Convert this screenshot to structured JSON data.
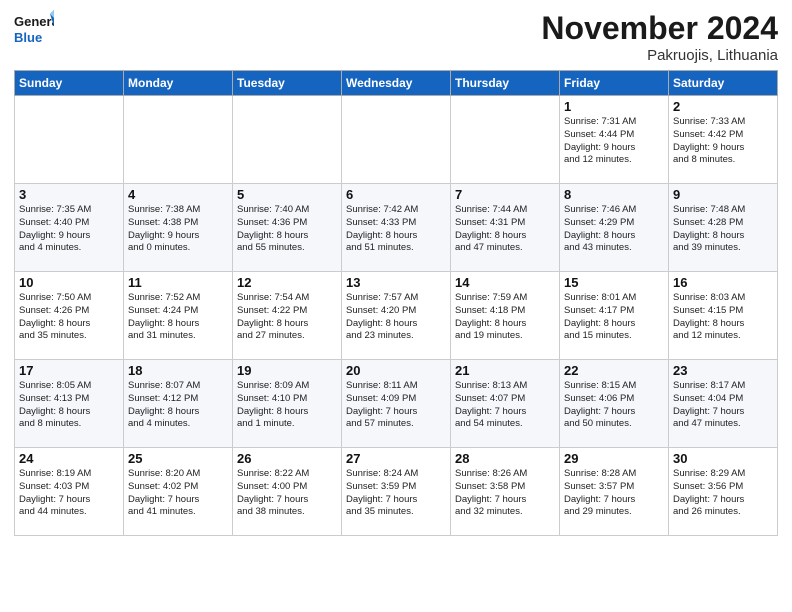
{
  "header": {
    "logo_line1": "General",
    "logo_line2": "Blue",
    "month_title": "November 2024",
    "location": "Pakruojis, Lithuania"
  },
  "days_of_week": [
    "Sunday",
    "Monday",
    "Tuesday",
    "Wednesday",
    "Thursday",
    "Friday",
    "Saturday"
  ],
  "weeks": [
    [
      {
        "day": "",
        "detail": ""
      },
      {
        "day": "",
        "detail": ""
      },
      {
        "day": "",
        "detail": ""
      },
      {
        "day": "",
        "detail": ""
      },
      {
        "day": "",
        "detail": ""
      },
      {
        "day": "1",
        "detail": "Sunrise: 7:31 AM\nSunset: 4:44 PM\nDaylight: 9 hours\nand 12 minutes."
      },
      {
        "day": "2",
        "detail": "Sunrise: 7:33 AM\nSunset: 4:42 PM\nDaylight: 9 hours\nand 8 minutes."
      }
    ],
    [
      {
        "day": "3",
        "detail": "Sunrise: 7:35 AM\nSunset: 4:40 PM\nDaylight: 9 hours\nand 4 minutes."
      },
      {
        "day": "4",
        "detail": "Sunrise: 7:38 AM\nSunset: 4:38 PM\nDaylight: 9 hours\nand 0 minutes."
      },
      {
        "day": "5",
        "detail": "Sunrise: 7:40 AM\nSunset: 4:36 PM\nDaylight: 8 hours\nand 55 minutes."
      },
      {
        "day": "6",
        "detail": "Sunrise: 7:42 AM\nSunset: 4:33 PM\nDaylight: 8 hours\nand 51 minutes."
      },
      {
        "day": "7",
        "detail": "Sunrise: 7:44 AM\nSunset: 4:31 PM\nDaylight: 8 hours\nand 47 minutes."
      },
      {
        "day": "8",
        "detail": "Sunrise: 7:46 AM\nSunset: 4:29 PM\nDaylight: 8 hours\nand 43 minutes."
      },
      {
        "day": "9",
        "detail": "Sunrise: 7:48 AM\nSunset: 4:28 PM\nDaylight: 8 hours\nand 39 minutes."
      }
    ],
    [
      {
        "day": "10",
        "detail": "Sunrise: 7:50 AM\nSunset: 4:26 PM\nDaylight: 8 hours\nand 35 minutes."
      },
      {
        "day": "11",
        "detail": "Sunrise: 7:52 AM\nSunset: 4:24 PM\nDaylight: 8 hours\nand 31 minutes."
      },
      {
        "day": "12",
        "detail": "Sunrise: 7:54 AM\nSunset: 4:22 PM\nDaylight: 8 hours\nand 27 minutes."
      },
      {
        "day": "13",
        "detail": "Sunrise: 7:57 AM\nSunset: 4:20 PM\nDaylight: 8 hours\nand 23 minutes."
      },
      {
        "day": "14",
        "detail": "Sunrise: 7:59 AM\nSunset: 4:18 PM\nDaylight: 8 hours\nand 19 minutes."
      },
      {
        "day": "15",
        "detail": "Sunrise: 8:01 AM\nSunset: 4:17 PM\nDaylight: 8 hours\nand 15 minutes."
      },
      {
        "day": "16",
        "detail": "Sunrise: 8:03 AM\nSunset: 4:15 PM\nDaylight: 8 hours\nand 12 minutes."
      }
    ],
    [
      {
        "day": "17",
        "detail": "Sunrise: 8:05 AM\nSunset: 4:13 PM\nDaylight: 8 hours\nand 8 minutes."
      },
      {
        "day": "18",
        "detail": "Sunrise: 8:07 AM\nSunset: 4:12 PM\nDaylight: 8 hours\nand 4 minutes."
      },
      {
        "day": "19",
        "detail": "Sunrise: 8:09 AM\nSunset: 4:10 PM\nDaylight: 8 hours\nand 1 minute."
      },
      {
        "day": "20",
        "detail": "Sunrise: 8:11 AM\nSunset: 4:09 PM\nDaylight: 7 hours\nand 57 minutes."
      },
      {
        "day": "21",
        "detail": "Sunrise: 8:13 AM\nSunset: 4:07 PM\nDaylight: 7 hours\nand 54 minutes."
      },
      {
        "day": "22",
        "detail": "Sunrise: 8:15 AM\nSunset: 4:06 PM\nDaylight: 7 hours\nand 50 minutes."
      },
      {
        "day": "23",
        "detail": "Sunrise: 8:17 AM\nSunset: 4:04 PM\nDaylight: 7 hours\nand 47 minutes."
      }
    ],
    [
      {
        "day": "24",
        "detail": "Sunrise: 8:19 AM\nSunset: 4:03 PM\nDaylight: 7 hours\nand 44 minutes."
      },
      {
        "day": "25",
        "detail": "Sunrise: 8:20 AM\nSunset: 4:02 PM\nDaylight: 7 hours\nand 41 minutes."
      },
      {
        "day": "26",
        "detail": "Sunrise: 8:22 AM\nSunset: 4:00 PM\nDaylight: 7 hours\nand 38 minutes."
      },
      {
        "day": "27",
        "detail": "Sunrise: 8:24 AM\nSunset: 3:59 PM\nDaylight: 7 hours\nand 35 minutes."
      },
      {
        "day": "28",
        "detail": "Sunrise: 8:26 AM\nSunset: 3:58 PM\nDaylight: 7 hours\nand 32 minutes."
      },
      {
        "day": "29",
        "detail": "Sunrise: 8:28 AM\nSunset: 3:57 PM\nDaylight: 7 hours\nand 29 minutes."
      },
      {
        "day": "30",
        "detail": "Sunrise: 8:29 AM\nSunset: 3:56 PM\nDaylight: 7 hours\nand 26 minutes."
      }
    ]
  ],
  "colors": {
    "header_bg": "#1565c0",
    "header_text": "#ffffff",
    "accent": "#1565c0"
  }
}
